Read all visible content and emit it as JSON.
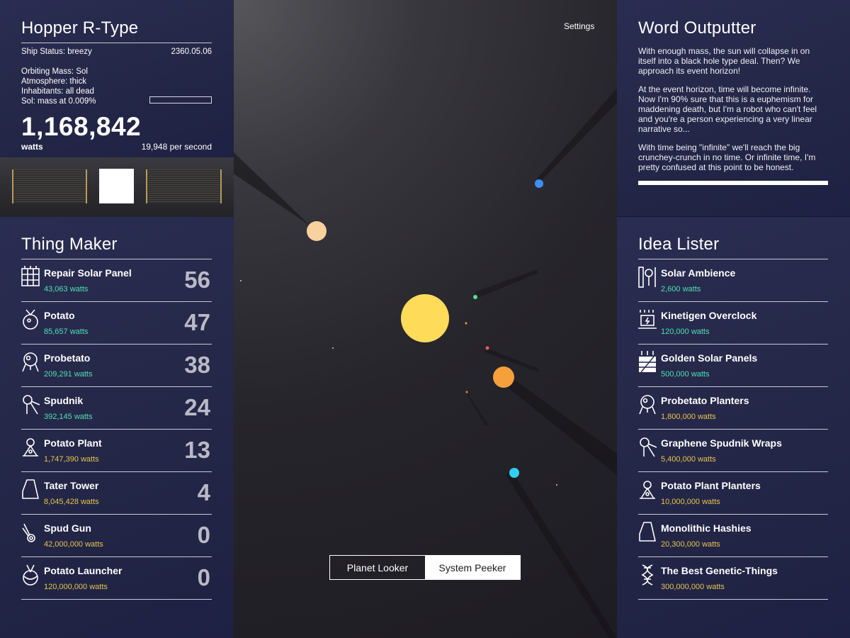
{
  "ship": {
    "title": "Hopper R-Type",
    "status": "Ship Status: breezy",
    "date": "2360.05.06",
    "orbiting": "Orbiting Mass: Sol",
    "atmosphere": "Atmosphere: thick",
    "inhabitants": "Inhabitants: all dead",
    "sol_mass": "Sol: mass at 0.009%",
    "sol_mass_fraction": 0.009,
    "watts": "1,168,842",
    "watts_unit": "watts",
    "rate": "19,948 per second"
  },
  "thing_maker": {
    "title": "Thing Maker",
    "items": [
      {
        "name": "Repair Solar Panel",
        "cost": "43,063 watts",
        "count": "56",
        "affordable": true,
        "icon": "solar-panel-icon"
      },
      {
        "name": "Potato",
        "cost": "85,657 watts",
        "count": "47",
        "affordable": true,
        "icon": "potato-icon"
      },
      {
        "name": "Probetato",
        "cost": "209,291 watts",
        "count": "38",
        "affordable": true,
        "icon": "probetato-icon"
      },
      {
        "name": "Spudnik",
        "cost": "392,145 watts",
        "count": "24",
        "affordable": true,
        "icon": "spudnik-icon"
      },
      {
        "name": "Potato Plant",
        "cost": "1,747,390 watts",
        "count": "13",
        "affordable": false,
        "icon": "potato-plant-icon"
      },
      {
        "name": "Tater Tower",
        "cost": "8,045,428 watts",
        "count": "4",
        "affordable": false,
        "icon": "tater-tower-icon"
      },
      {
        "name": "Spud Gun",
        "cost": "42,000,000 watts",
        "count": "0",
        "affordable": false,
        "icon": "spud-gun-icon"
      },
      {
        "name": "Potato Launcher",
        "cost": "120,000,000 watts",
        "count": "0",
        "affordable": false,
        "icon": "potato-launcher-icon"
      }
    ]
  },
  "word_outputter": {
    "title": "Word Outputter",
    "paragraphs": [
      "With enough mass, the sun will collapse in on itself into a black hole type deal. Then? We approach its event horizon!",
      "At the event horizon, time will become infinite. Now I'm 90% sure that this is a euphemism for maddening death, but I'm a robot who can't feel and you're a person experiencing a very linear narrative so...",
      "With time being \"infinite\" we'll reach the big crunchey-crunch in no time. Or infinite time, I'm pretty confused at this point to be honest."
    ]
  },
  "idea_lister": {
    "title": "Idea Lister",
    "items": [
      {
        "name": "Solar Ambience",
        "cost": "2,600 watts",
        "affordable": true,
        "icon": "solar-ambience-icon"
      },
      {
        "name": "Kinetigen Overclock",
        "cost": "120,000 watts",
        "affordable": true,
        "icon": "kinetigen-icon"
      },
      {
        "name": "Golden Solar Panels",
        "cost": "500,000 watts",
        "affordable": true,
        "icon": "golden-panels-icon"
      },
      {
        "name": "Probetato Planters",
        "cost": "1,800,000 watts",
        "affordable": false,
        "icon": "probetato-icon"
      },
      {
        "name": "Graphene Spudnik Wraps",
        "cost": "5,400,000 watts",
        "affordable": false,
        "icon": "spudnik-icon"
      },
      {
        "name": "Potato Plant Planters",
        "cost": "10,000,000 watts",
        "affordable": false,
        "icon": "potato-plant-icon"
      },
      {
        "name": "Monolithic Hashies",
        "cost": "20,300,000 watts",
        "affordable": false,
        "icon": "tater-tower-icon"
      },
      {
        "name": "The Best Genetic-Things",
        "cost": "300,000,000 watts",
        "affordable": false,
        "icon": "dna-icon"
      }
    ]
  },
  "system": {
    "settings": "Settings",
    "tabs": [
      {
        "label": "Planet Looker",
        "active": false
      },
      {
        "label": "System Peeker",
        "active": true
      }
    ]
  },
  "colors": {
    "affordable": "#4fe0b6",
    "unaffordable": "#e8c44e",
    "sun": "#fedc5a"
  }
}
